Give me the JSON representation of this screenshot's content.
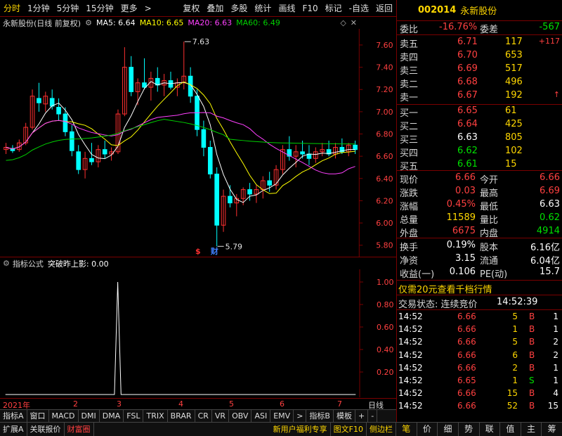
{
  "toolbar": {
    "periods": [
      "分时",
      "1分钟",
      "5分钟",
      "15分钟",
      "更多"
    ],
    "actions": [
      "复权",
      "叠加",
      "多股",
      "统计",
      "画线",
      "F10",
      "标记",
      "-自选",
      "返回"
    ]
  },
  "stock": {
    "code": "002014",
    "name": "永新股份"
  },
  "chart_title": {
    "name": "永新股份(日线 前复权)",
    "ma5": "MA5: 6.64",
    "ma10": "MA10: 6.65",
    "ma20": "MA20: 6.63",
    "ma60": "MA60: 6.49"
  },
  "indicator": {
    "name": "指标公式",
    "label": "突破昨上影: 0.00"
  },
  "chart_data": [
    {
      "type": "candlestick",
      "title": "",
      "yticks": [
        "7.60",
        "7.40",
        "7.20",
        "7.00",
        "6.80",
        "6.60",
        "6.40",
        "6.20",
        "6.00",
        "5.80"
      ],
      "ylim": [
        5.76,
        7.72
      ],
      "annotations": [
        {
          "text": "7.63",
          "value": 7.63
        },
        {
          "text": "5.79",
          "value": 5.79
        }
      ],
      "markers": [
        "$",
        "财"
      ],
      "series": [
        {
          "name": "MA5",
          "color": "#ffffff"
        },
        {
          "name": "MA10",
          "color": "#ffff00"
        },
        {
          "name": "MA20",
          "color": "#ff40ff"
        },
        {
          "name": "MA60",
          "color": "#00d000"
        }
      ],
      "candles": [
        {
          "o": 6.66,
          "h": 6.72,
          "l": 6.62,
          "c": 6.68
        },
        {
          "o": 6.67,
          "h": 6.7,
          "l": 6.63,
          "c": 6.65
        },
        {
          "o": 6.66,
          "h": 6.75,
          "l": 6.64,
          "c": 6.72
        },
        {
          "o": 6.72,
          "h": 6.9,
          "l": 6.7,
          "c": 6.86
        },
        {
          "o": 6.86,
          "h": 7.2,
          "l": 6.84,
          "c": 7.14
        },
        {
          "o": 7.12,
          "h": 7.26,
          "l": 7.0,
          "c": 7.08
        },
        {
          "o": 7.07,
          "h": 7.18,
          "l": 7.0,
          "c": 7.14
        },
        {
          "o": 7.12,
          "h": 7.2,
          "l": 7.02,
          "c": 7.05
        },
        {
          "o": 7.04,
          "h": 7.12,
          "l": 6.92,
          "c": 6.98
        },
        {
          "o": 6.98,
          "h": 7.04,
          "l": 6.78,
          "c": 6.82
        },
        {
          "o": 6.82,
          "h": 6.88,
          "l": 6.6,
          "c": 6.65
        },
        {
          "o": 6.64,
          "h": 6.7,
          "l": 6.44,
          "c": 6.48
        },
        {
          "o": 6.48,
          "h": 6.64,
          "l": 6.4,
          "c": 6.58
        },
        {
          "o": 6.58,
          "h": 6.72,
          "l": 6.52,
          "c": 6.55
        },
        {
          "o": 6.55,
          "h": 6.7,
          "l": 6.5,
          "c": 6.66
        },
        {
          "o": 6.66,
          "h": 6.74,
          "l": 6.58,
          "c": 6.62
        },
        {
          "o": 6.62,
          "h": 6.68,
          "l": 6.56,
          "c": 6.64
        },
        {
          "o": 6.64,
          "h": 7.02,
          "l": 6.62,
          "c": 6.98
        },
        {
          "o": 6.98,
          "h": 7.58,
          "l": 6.96,
          "c": 7.4
        },
        {
          "o": 7.4,
          "h": 7.5,
          "l": 7.14,
          "c": 7.18
        },
        {
          "o": 7.18,
          "h": 7.3,
          "l": 7.06,
          "c": 7.26
        },
        {
          "o": 7.26,
          "h": 7.48,
          "l": 7.2,
          "c": 7.22
        },
        {
          "o": 7.22,
          "h": 7.36,
          "l": 7.1,
          "c": 7.3
        },
        {
          "o": 7.3,
          "h": 7.4,
          "l": 7.18,
          "c": 7.24
        },
        {
          "o": 7.24,
          "h": 7.34,
          "l": 7.14,
          "c": 7.28
        },
        {
          "o": 7.28,
          "h": 7.36,
          "l": 7.2,
          "c": 7.22
        },
        {
          "o": 7.22,
          "h": 7.3,
          "l": 7.14,
          "c": 7.26
        },
        {
          "o": 7.26,
          "h": 7.63,
          "l": 7.2,
          "c": 7.32
        },
        {
          "o": 7.32,
          "h": 7.4,
          "l": 7.08,
          "c": 7.14
        },
        {
          "o": 7.14,
          "h": 7.2,
          "l": 6.78,
          "c": 6.84
        },
        {
          "o": 6.84,
          "h": 6.92,
          "l": 6.6,
          "c": 6.68
        },
        {
          "o": 6.68,
          "h": 6.74,
          "l": 6.4,
          "c": 6.44
        },
        {
          "o": 6.44,
          "h": 6.5,
          "l": 5.79,
          "c": 5.98
        },
        {
          "o": 5.98,
          "h": 6.3,
          "l": 5.92,
          "c": 6.24
        },
        {
          "o": 6.24,
          "h": 6.34,
          "l": 6.14,
          "c": 6.18
        },
        {
          "o": 6.18,
          "h": 6.26,
          "l": 6.06,
          "c": 6.22
        },
        {
          "o": 6.22,
          "h": 6.32,
          "l": 6.16,
          "c": 6.3
        },
        {
          "o": 6.3,
          "h": 6.36,
          "l": 6.2,
          "c": 6.26
        },
        {
          "o": 6.26,
          "h": 6.34,
          "l": 6.18,
          "c": 6.3
        },
        {
          "o": 6.3,
          "h": 6.42,
          "l": 6.22,
          "c": 6.38
        },
        {
          "o": 6.38,
          "h": 6.46,
          "l": 6.28,
          "c": 6.34
        },
        {
          "o": 6.34,
          "h": 6.52,
          "l": 6.3,
          "c": 6.48
        },
        {
          "o": 6.48,
          "h": 6.7,
          "l": 6.44,
          "c": 6.66
        },
        {
          "o": 6.66,
          "h": 6.78,
          "l": 6.56,
          "c": 6.6
        },
        {
          "o": 6.6,
          "h": 6.7,
          "l": 6.5,
          "c": 6.64
        },
        {
          "o": 6.64,
          "h": 6.74,
          "l": 6.58,
          "c": 6.62
        },
        {
          "o": 6.62,
          "h": 6.7,
          "l": 6.52,
          "c": 6.58
        },
        {
          "o": 6.58,
          "h": 6.68,
          "l": 6.54,
          "c": 6.64
        },
        {
          "o": 6.64,
          "h": 6.72,
          "l": 6.6,
          "c": 6.66
        },
        {
          "o": 6.66,
          "h": 6.74,
          "l": 6.6,
          "c": 6.62
        },
        {
          "o": 6.62,
          "h": 6.72,
          "l": 6.58,
          "c": 6.68
        },
        {
          "o": 6.68,
          "h": 6.76,
          "l": 6.62,
          "c": 6.64
        },
        {
          "o": 6.64,
          "h": 6.72,
          "l": 6.6,
          "c": 6.7
        },
        {
          "o": 6.7,
          "h": 6.74,
          "l": 6.62,
          "c": 6.66
        }
      ]
    },
    {
      "type": "line",
      "title": "",
      "yticks": [
        "1.00",
        "0.80",
        "0.60",
        "0.40",
        "0.20"
      ],
      "ylim": [
        0,
        1.1
      ],
      "spikes": [
        {
          "category_index": 17,
          "value": 1.0
        }
      ]
    }
  ],
  "xaxis": {
    "labels": [
      "2021年",
      "2",
      "3",
      "4",
      "5",
      "6",
      "7"
    ],
    "right": "日线"
  },
  "tabs_row1": [
    "指标A",
    "窗口",
    "MACD",
    "DMI",
    "DMA",
    "FSL",
    "TRIX",
    "BRAR",
    "CR",
    "VR",
    "OBV",
    "ASI",
    "EMV",
    ">",
    "指标B",
    "模板",
    "+",
    "-"
  ],
  "tabs_row2": [
    "扩展A",
    "关联报价",
    "财富圈",
    "新用户福利专享",
    "图文F10",
    "侧边栏"
  ],
  "order": {
    "weibi_label": "委比",
    "weibi": "-16.76%",
    "weicha_label": "委差",
    "weicha": "-567",
    "asks": [
      {
        "label": "卖五",
        "price": "6.71",
        "vol": "117",
        "extra": "+117"
      },
      {
        "label": "卖四",
        "price": "6.70",
        "vol": "653",
        "extra": ""
      },
      {
        "label": "卖三",
        "price": "6.69",
        "vol": "517",
        "extra": ""
      },
      {
        "label": "卖二",
        "price": "6.68",
        "vol": "496",
        "extra": ""
      },
      {
        "label": "卖一",
        "price": "6.67",
        "vol": "192",
        "extra": "↑"
      }
    ],
    "bids": [
      {
        "label": "买一",
        "price": "6.65",
        "vol": "61"
      },
      {
        "label": "买二",
        "price": "6.64",
        "vol": "425"
      },
      {
        "label": "买三",
        "price": "6.63",
        "vol": "805"
      },
      {
        "label": "买四",
        "price": "6.62",
        "vol": "102"
      },
      {
        "label": "买五",
        "price": "6.61",
        "vol": "15"
      }
    ]
  },
  "stats": [
    {
      "l1": "现价",
      "v1": "6.66",
      "l2": "今开",
      "v2": "6.66",
      "c1": "red",
      "c2": "red"
    },
    {
      "l1": "涨跌",
      "v1": "0.03",
      "l2": "最高",
      "v2": "6.69",
      "c1": "red",
      "c2": "red"
    },
    {
      "l1": "涨幅",
      "v1": "0.45%",
      "l2": "最低",
      "v2": "6.63",
      "c1": "red",
      "c2": "white"
    },
    {
      "l1": "总量",
      "v1": "11589",
      "l2": "量比",
      "v2": "0.62",
      "c1": "yellow",
      "c2": "green"
    },
    {
      "l1": "外盘",
      "v1": "6675",
      "l2": "内盘",
      "v2": "4914",
      "c1": "red",
      "c2": "green"
    }
  ],
  "stats2": [
    {
      "l1": "换手",
      "v1": "0.19%",
      "l2": "股本",
      "v2": "6.16亿"
    },
    {
      "l1": "净资",
      "v1": "3.15",
      "l2": "流通",
      "v2": "6.04亿"
    },
    {
      "l1": "收益(一)",
      "v1": "0.106",
      "l2": "PE(动)",
      "v2": "15.7"
    }
  ],
  "promo": "仅需20元查看千档行情",
  "trade_status": {
    "label": "交易状态: 连续竞价",
    "time": "14:52:39"
  },
  "ticks": [
    {
      "t": "14:52",
      "p": "6.66",
      "v": "5",
      "d": "B",
      "n": "1"
    },
    {
      "t": "14:52",
      "p": "6.66",
      "v": "1",
      "d": "B",
      "n": "1"
    },
    {
      "t": "14:52",
      "p": "6.66",
      "v": "5",
      "d": "B",
      "n": "2"
    },
    {
      "t": "14:52",
      "p": "6.66",
      "v": "6",
      "d": "B",
      "n": "2"
    },
    {
      "t": "14:52",
      "p": "6.66",
      "v": "2",
      "d": "B",
      "n": "1"
    },
    {
      "t": "14:52",
      "p": "6.65",
      "v": "1",
      "d": "S",
      "n": "1"
    },
    {
      "t": "14:52",
      "p": "6.66",
      "v": "15",
      "d": "B",
      "n": "4"
    },
    {
      "t": "14:52",
      "p": "6.66",
      "v": "52",
      "d": "B",
      "n": "15"
    }
  ],
  "bottom_right": [
    "笔",
    "价",
    "细",
    "势",
    "联",
    "值",
    "主",
    "筹"
  ]
}
